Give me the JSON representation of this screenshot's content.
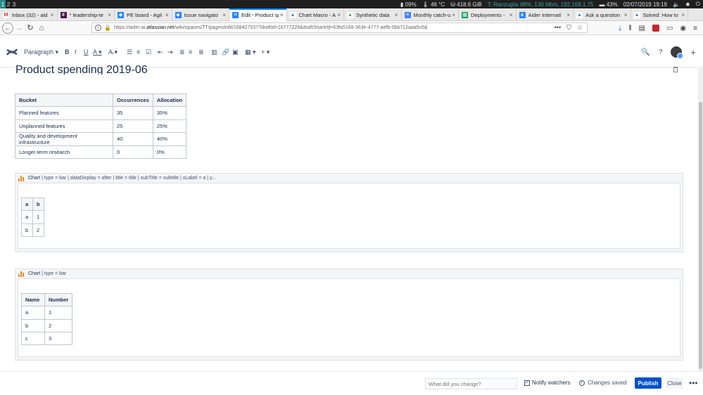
{
  "system_bar": {
    "workspaces": [
      "1",
      "2",
      "3"
    ],
    "cpu": "09%",
    "temperature": "46 °C",
    "disk": "418.6 GiB",
    "network": "T: Ranzuglia  88%, 130 Mb/s, 192.168.1.75",
    "battery": "43%",
    "datetime": "02/07/2019 19:19"
  },
  "tabs": [
    {
      "label": "Inbox (32) - aid",
      "favicon": "gmail-icon",
      "color": "#ffffff",
      "text": "M",
      "text_color": "#d93025"
    },
    {
      "label": "* leadership-te",
      "favicon": "slack-icon",
      "color": "#4a154b",
      "text": "#",
      "text_color": "#ffffff"
    },
    {
      "label": "PE board - Agil",
      "favicon": "jira-icon",
      "color": "#2684ff",
      "text": "◆",
      "text_color": "#ffffff"
    },
    {
      "label": "Issue navigato",
      "favicon": "jira-icon",
      "color": "#2684ff",
      "text": "◆",
      "text_color": "#ffffff"
    },
    {
      "label": "Edit - Product sp",
      "favicon": "confluence-icon",
      "color": "#2684ff",
      "text": "✕",
      "text_color": "#ffffff",
      "active": true
    },
    {
      "label": "Chart Macro - A",
      "favicon": "atlassian-icon",
      "color": "#ffffff",
      "text": "▲",
      "text_color": "#2684ff"
    },
    {
      "label": "Synthetic data",
      "favicon": "drive-icon",
      "color": "#ffffff",
      "text": "▲",
      "text_color": "#34a853"
    },
    {
      "label": "Monthly catch-u",
      "favicon": "docs-icon",
      "color": "#4285f4",
      "text": "≡",
      "text_color": "#ffffff"
    },
    {
      "label": "Deployments -",
      "favicon": "sheets-icon",
      "color": "#0f9d58",
      "text": "▦",
      "text_color": "#ffffff"
    },
    {
      "label": "Aider Internati",
      "favicon": "aider-icon",
      "color": "#2684ff",
      "text": "a",
      "text_color": "#ffffff"
    },
    {
      "label": "Ask a question",
      "favicon": "atlassian-icon",
      "color": "#ffffff",
      "text": "▲",
      "text_color": "#2684ff"
    },
    {
      "label": "Solved: How to",
      "favicon": "atlassian-icon",
      "color": "#ffffff",
      "text": "▲",
      "text_color": "#2684ff"
    }
  ],
  "url_bar": {
    "prefix": "https://aider-ai.",
    "domain": "atlassian.net",
    "path": "/wiki/spaces/TT/pages/edit/168427537?draftId=16777229&draftShareId=63fa5168-363e-4777-aefb-0bb712aaa5c6&"
  },
  "editor_toolbar": {
    "paragraph_label": "Paragraph"
  },
  "page": {
    "title": "Product spending 2019-06",
    "table": {
      "headers": [
        "Bucket",
        "Occurrences",
        "Allocation"
      ],
      "rows": [
        [
          "Planned features",
          "35",
          "35%"
        ],
        [
          "Unplanned features",
          "25",
          "25%"
        ],
        [
          "Quality and development infrastructure",
          "40",
          "40%"
        ],
        [
          "Longer-term research",
          "0",
          "0%"
        ]
      ]
    },
    "macros": [
      {
        "name": "Chart",
        "params": "| type = bar | dataDisplay = after | title = title | subTitle = subtitle | xLabel = a | y...",
        "table": {
          "headers": [
            "a",
            "b"
          ],
          "rows": [
            [
              "a",
              "1"
            ],
            [
              "b",
              "2"
            ]
          ]
        }
      },
      {
        "name": "Chart",
        "params": "| type = bar",
        "table": {
          "headers": [
            "Name",
            "Number"
          ],
          "rows": [
            [
              "a",
              "1"
            ],
            [
              "b",
              "2"
            ],
            [
              "c",
              "3"
            ]
          ]
        }
      }
    ]
  },
  "footer": {
    "change_placeholder": "What did you change?",
    "notify_label": "Notify watchers",
    "notify_checked": true,
    "saved_label": "Changes saved",
    "publish_label": "Publish",
    "close_label": "Close",
    "more_label": "•••"
  }
}
